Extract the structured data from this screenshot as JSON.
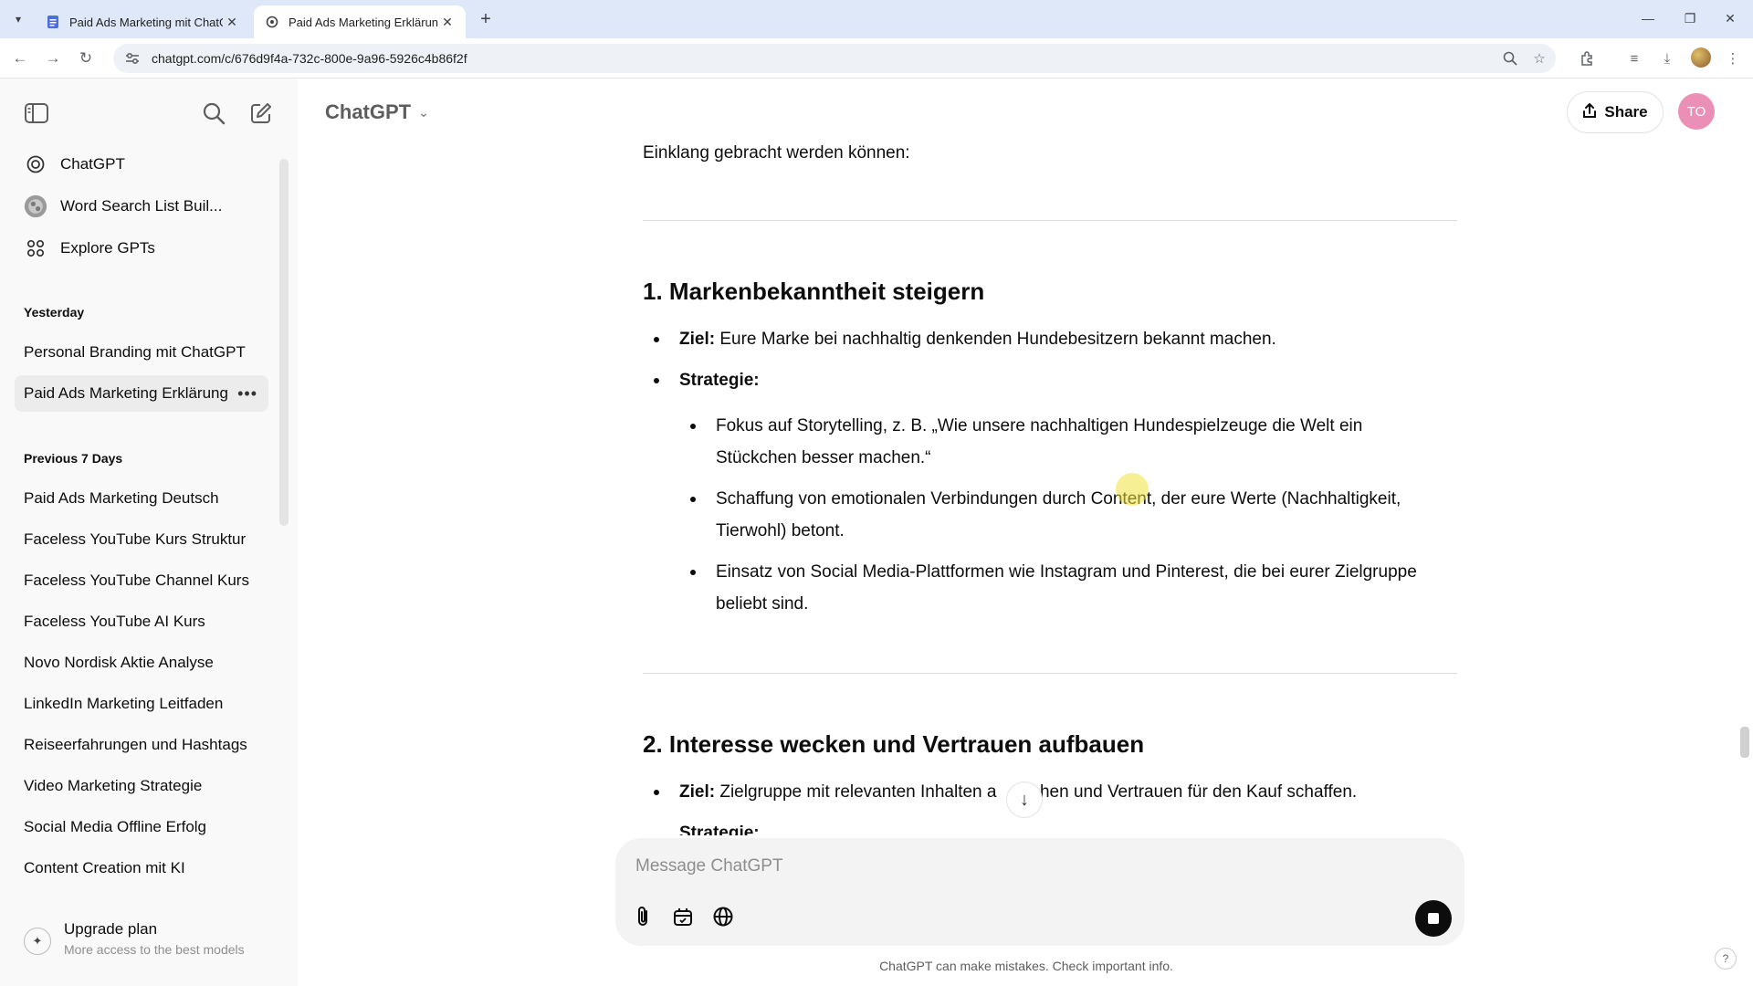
{
  "browser": {
    "tabs": [
      {
        "title": "Paid Ads Marketing mit ChatGP",
        "active": false
      },
      {
        "title": "Paid Ads Marketing Erklärung",
        "active": true
      }
    ],
    "url": "chatgpt.com/c/676d9f4a-732c-800e-9a96-5926c4b86f2f"
  },
  "sidebar": {
    "top_items": [
      {
        "label": "ChatGPT",
        "icon": "openai-logo-icon"
      },
      {
        "label": "Word Search List Buil...",
        "icon": "gpt-avatar-icon"
      },
      {
        "label": "Explore GPTs",
        "icon": "grid-icon"
      }
    ],
    "sections": [
      {
        "heading": "Yesterday",
        "items": [
          "Personal Branding mit ChatGPT",
          "Paid Ads Marketing Erklärung"
        ]
      },
      {
        "heading": "Previous 7 Days",
        "items": [
          "Paid Ads Marketing Deutsch",
          "Faceless YouTube Kurs Struktur",
          "Faceless YouTube Channel Kurs",
          "Faceless YouTube AI Kurs",
          "Novo Nordisk Aktie Analyse",
          "LinkedIn Marketing Leitfaden",
          "Reiseerfahrungen und Hashtags",
          "Video Marketing Strategie",
          "Social Media Offline Erfolg",
          "Content Creation mit KI"
        ]
      }
    ],
    "active_item": "Paid Ads Marketing Erklärung",
    "upgrade": {
      "title": "Upgrade plan",
      "subtitle": "More access to the best models"
    }
  },
  "header": {
    "model": "ChatGPT",
    "share_label": "Share",
    "avatar_initials": "TO"
  },
  "conversation": {
    "intro": "Einklang gebracht werden können:",
    "section1": {
      "heading": "1. Markenbekanntheit steigern",
      "goal_label": "Ziel:",
      "goal_text": " Eure Marke bei nachhaltig denkenden Hundebesitzern bekannt machen.",
      "strategy_label": "Strategie:",
      "strategy_lines": [
        "Fokus auf Storytelling, z. B. „Wie unsere nachhaltigen Hundespielzeuge die Welt ein",
        "Stückchen besser machen.“",
        "Schaffung von emotionalen Verbindungen durch Content, der eure Werte (Nachhaltigkeit,",
        "Tierwohl) betont.",
        "Einsatz von Social Media-Plattformen wie Instagram und Pinterest, die bei eurer Zielgruppe",
        "beliebt sind."
      ]
    },
    "section2": {
      "heading": "2. Interesse wecken und Vertrauen aufbauen",
      "goal_label": "Ziel:",
      "goal_text": " Zielgruppe mit relevanten Inhalten a    rechen und Vertrauen für den Kauf schaffen.",
      "strategy_label": "Strategie:"
    }
  },
  "composer": {
    "placeholder": "Message ChatGPT",
    "disclaimer": "ChatGPT can make mistakes. Check important info.",
    "help": "?"
  }
}
